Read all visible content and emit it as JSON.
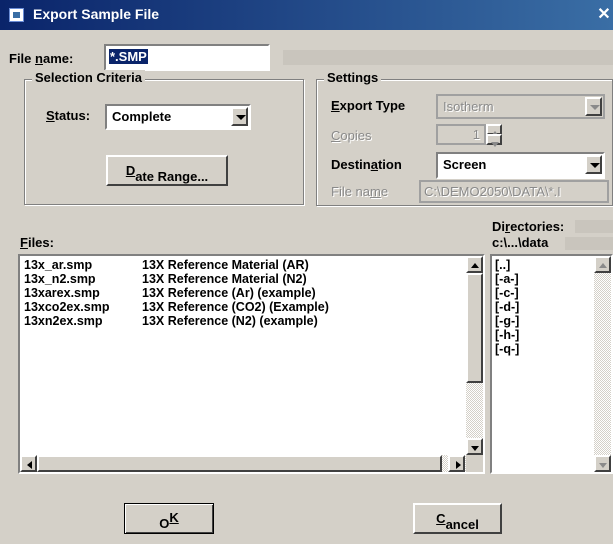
{
  "window": {
    "title": "Export Sample File"
  },
  "file_name": {
    "label_pre": "File ",
    "label_key": "n",
    "label_post": "ame:",
    "value": "*.SMP"
  },
  "selection": {
    "legend": "Selection Criteria",
    "status_label_key": "S",
    "status_label_post": "tatus:",
    "status_value": "Complete",
    "date_range_key": "D",
    "date_range_post": "ate Range..."
  },
  "settings": {
    "legend": "Settings",
    "export_type_key": "E",
    "export_type_post": "xport Type",
    "export_type_value": "Isotherm",
    "copies_key": "C",
    "copies_post": "opies",
    "copies_value": "1",
    "destination_pre": "Destin",
    "destination_key": "a",
    "destination_post": "tion",
    "destination_value": "Screen",
    "file_name_pre": "File na",
    "file_name_key": "m",
    "file_name_post": "e",
    "file_name_value": "C:\\DEMO2050\\DATA\\*.I"
  },
  "files": {
    "label_key": "F",
    "label_post": "iles:",
    "items": [
      {
        "name": "13x_ar.smp",
        "desc": "13X Reference Material (AR)"
      },
      {
        "name": "13x_n2.smp",
        "desc": "13X Reference Material (N2)"
      },
      {
        "name": "13xarex.smp",
        "desc": "13X Reference (Ar) (example)"
      },
      {
        "name": "13xco2ex.smp",
        "desc": "13X Reference (CO2) (Example)"
      },
      {
        "name": "13xn2ex.smp",
        "desc": "13X Reference (N2) (example)"
      }
    ]
  },
  "directories": {
    "label_pre": "Di",
    "label_key": "r",
    "label_post": "ectories:",
    "path": "c:\\...\\data",
    "items": [
      "[..]",
      "[-a-]",
      "[-c-]",
      "[-d-]",
      "[-g-]",
      "[-h-]",
      "[-q-]"
    ]
  },
  "buttons": {
    "ok_pre": "O",
    "ok_key": "K",
    "cancel_key": "C",
    "cancel_post": "ancel"
  }
}
